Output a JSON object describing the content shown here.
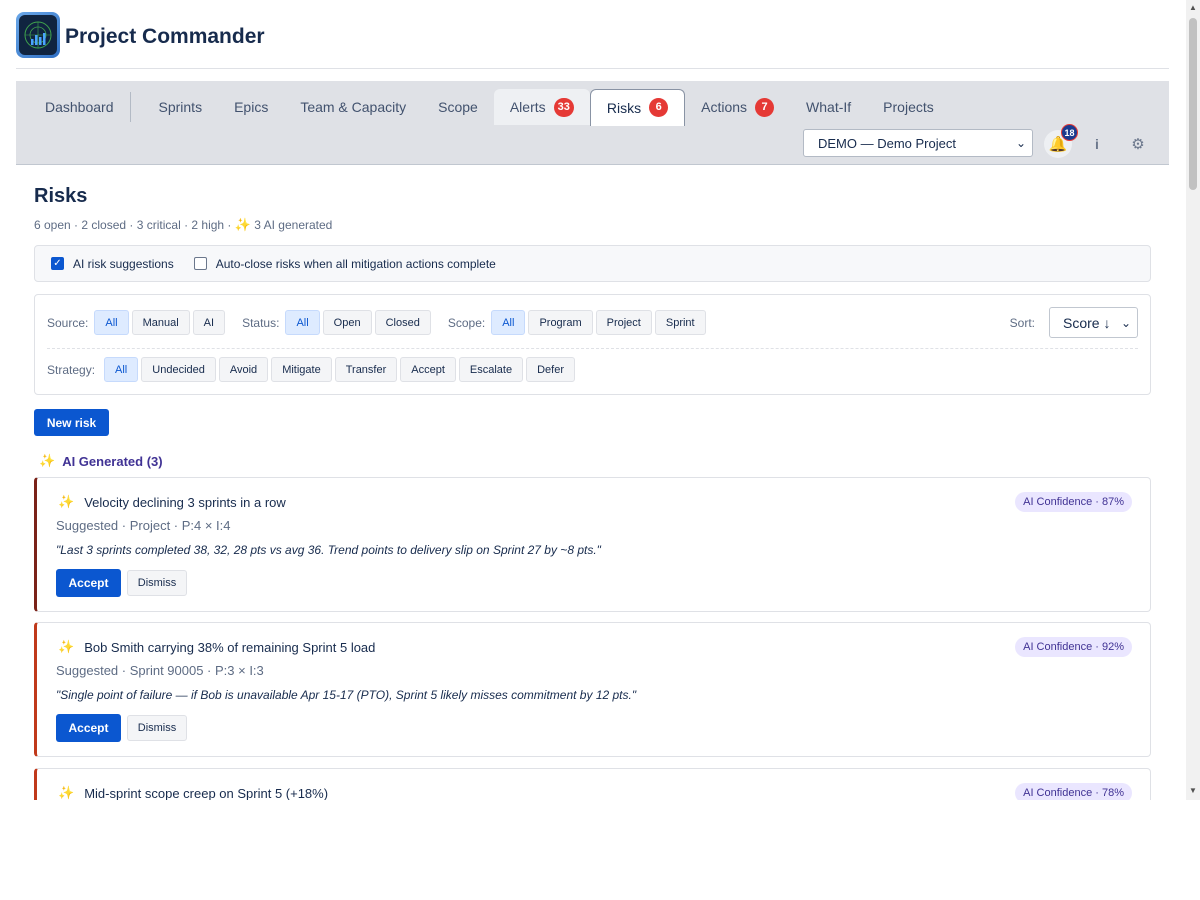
{
  "app": {
    "title": "Project Commander",
    "logo_icon": "radar-chart-icon"
  },
  "nav": {
    "tabs": [
      {
        "label": "Dashboard"
      },
      {
        "label": "Sprints"
      },
      {
        "label": "Epics"
      },
      {
        "label": "Team & Capacity"
      },
      {
        "label": "Scope"
      },
      {
        "label": "Alerts",
        "badge": "33"
      },
      {
        "label": "Risks",
        "badge": "6",
        "active": true
      },
      {
        "label": "Actions",
        "badge": "7"
      },
      {
        "label": "What-If"
      },
      {
        "label": "Projects"
      }
    ],
    "project_selected": "DEMO — Demo Project",
    "notifications_count": "18",
    "info_label": "i",
    "bell_glyph": "🔔",
    "gear_glyph": "⚙"
  },
  "page": {
    "title": "Risks",
    "summary_prefix": "6 open · 2 closed · 3 critical · 2 high · ",
    "summary_suffix": " 3 AI generated"
  },
  "settings": {
    "ai_suggestions_label": "AI risk suggestions",
    "ai_suggestions_checked": true,
    "auto_close_label": "Auto-close risks when all mitigation actions complete",
    "auto_close_checked": false
  },
  "filters": {
    "source": {
      "label": "Source:",
      "options": [
        "All",
        "Manual",
        "AI"
      ],
      "active": "All"
    },
    "status": {
      "label": "Status:",
      "options": [
        "All",
        "Open",
        "Closed"
      ],
      "active": "All"
    },
    "scope": {
      "label": "Scope:",
      "options": [
        "All",
        "Program",
        "Project",
        "Sprint"
      ],
      "active": "All"
    },
    "strategy": {
      "label": "Strategy:",
      "options": [
        "All",
        "Undecided",
        "Avoid",
        "Mitigate",
        "Transfer",
        "Accept",
        "Escalate",
        "Defer"
      ],
      "active": "All"
    },
    "sort": {
      "label": "Sort:",
      "value": "Score ↓"
    }
  },
  "actions": {
    "new_risk_label": "New risk"
  },
  "ai_section": {
    "heading": "AI Generated (3)",
    "cards": [
      {
        "title": "Velocity declining 3 sprints in a row",
        "meta": "Suggested · Project · P:4 × I:4",
        "description": "\"Last 3 sprints completed 38, 32, 28 pts vs avg 36. Trend points to delivery slip on Sprint 27 by ~8 pts.\"",
        "confidence": "AI Confidence · 87%",
        "accept_label": "Accept",
        "dismiss_label": "Dismiss",
        "accent_color": "#7a2218"
      },
      {
        "title": "Bob Smith carrying 38% of remaining Sprint 5 load",
        "meta": "Suggested · Sprint 90005 · P:3 × I:3",
        "description": "\"Single point of failure — if Bob is unavailable Apr 15-17 (PTO), Sprint 5 likely misses commitment by 12 pts.\"",
        "confidence": "AI Confidence · 92%",
        "accept_label": "Accept",
        "dismiss_label": "Dismiss",
        "accent_color": "#c0391b"
      },
      {
        "title": "Mid-sprint scope creep on Sprint 5 (+18%)",
        "confidence": "AI Confidence · 78%",
        "accent_color": "#c0391b"
      }
    ]
  },
  "colors": {
    "primary": "#0b57d0",
    "badge_red": "#e53935",
    "ai_purple": "#403294",
    "ai_bg": "#eae6ff"
  }
}
